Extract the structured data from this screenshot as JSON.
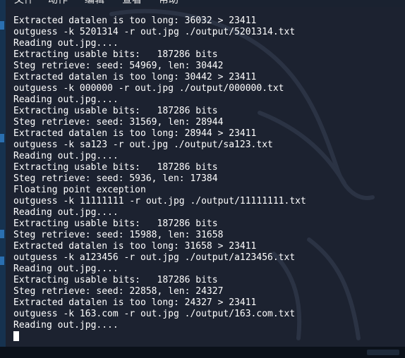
{
  "menubar": {
    "items": [
      "文件",
      "动作",
      "编辑",
      "查看",
      "帮助"
    ]
  },
  "terminal": {
    "lines": [
      "Extracted datalen is too long: 36032 > 23411",
      "outguess -k 5201314 -r out.jpg ./output/5201314.txt",
      "Reading out.jpg....",
      "Extracting usable bits:   187286 bits",
      "Steg retrieve: seed: 54969, len: 30442",
      "Extracted datalen is too long: 30442 > 23411",
      "outguess -k 000000 -r out.jpg ./output/000000.txt",
      "Reading out.jpg....",
      "Extracting usable bits:   187286 bits",
      "Steg retrieve: seed: 31569, len: 28944",
      "Extracted datalen is too long: 28944 > 23411",
      "outguess -k sa123 -r out.jpg ./output/sa123.txt",
      "Reading out.jpg....",
      "Extracting usable bits:   187286 bits",
      "Steg retrieve: seed: 5936, len: 17384",
      "Floating point exception",
      "outguess -k 11111111 -r out.jpg ./output/11111111.txt",
      "Reading out.jpg....",
      "Extracting usable bits:   187286 bits",
      "Steg retrieve: seed: 15988, len: 31658",
      "Extracted datalen is too long: 31658 > 23411",
      "outguess -k a123456 -r out.jpg ./output/a123456.txt",
      "Reading out.jpg....",
      "Extracting usable bits:   187286 bits",
      "Steg retrieve: seed: 22858, len: 24327",
      "Extracted datalen is too long: 24327 > 23411",
      "outguess -k 163.com -r out.jpg ./output/163.com.txt",
      "Reading out.jpg...."
    ]
  },
  "colors": {
    "terminal_bg": "#1c2230",
    "terminal_fg": "#ffffff",
    "menubar_bg": "#1a2230",
    "left_strip": "#16324f"
  },
  "icons": {
    "cursor": "block-cursor-icon",
    "watermark": "kali-dragon-icon"
  }
}
